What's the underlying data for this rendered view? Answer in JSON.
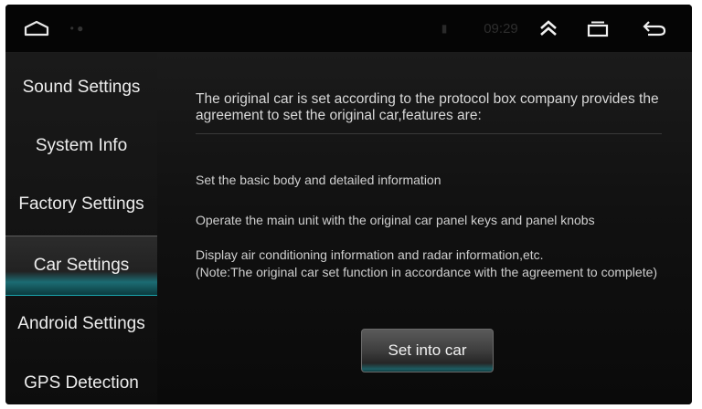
{
  "statusbar": {
    "home_icon": "home-icon",
    "indicator": "• ●",
    "signal": "▮",
    "time": "09:29",
    "up_icon": "double-chevron-up-icon",
    "recent_icon": "recent-apps-icon",
    "back_icon": "back-arrow-icon"
  },
  "sidebar": {
    "items": [
      {
        "label": "Sound Settings"
      },
      {
        "label": "System Info"
      },
      {
        "label": "Factory Settings"
      },
      {
        "label": "Car Settings",
        "active": true
      },
      {
        "label": "Android Settings"
      },
      {
        "label": "GPS Detection"
      }
    ]
  },
  "main": {
    "intro": "The original car is set according to the protocol box company provides the agreement to set the original car,features are:",
    "features": [
      "Set the basic body and detailed information",
      "Operate the main unit with the original car panel keys and panel knobs",
      "Display air conditioning information and radar information,etc."
    ],
    "note": "(Note:The original car set function in accordance with the agreement to complete)",
    "button_label": "Set into car"
  },
  "colors": {
    "accent": "#1aa7b0",
    "background": "#111111",
    "text": "#e0e0e0"
  }
}
